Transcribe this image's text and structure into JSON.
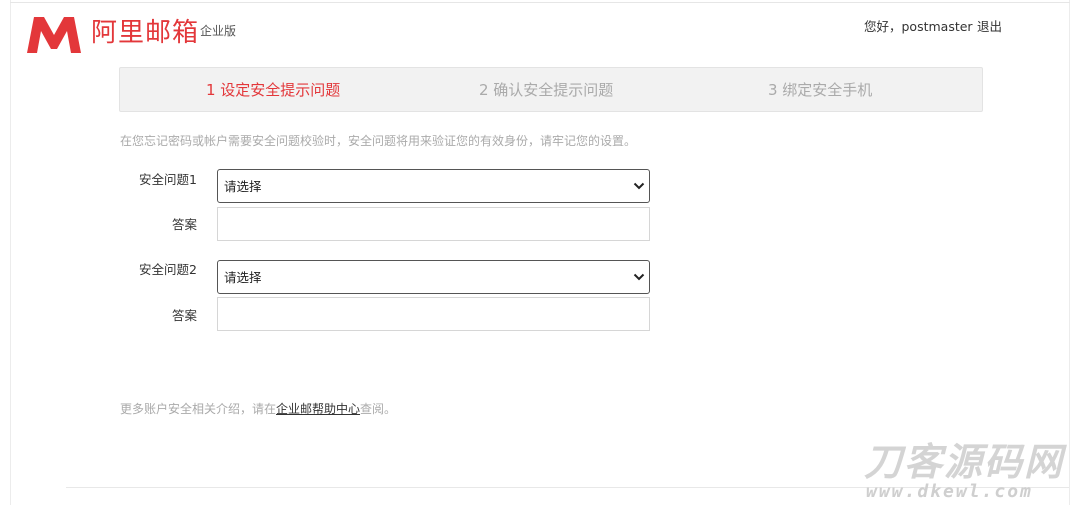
{
  "header": {
    "brand": "阿里邮箱",
    "edition": "企业版",
    "greeting": "您好，postmaster",
    "logout": "退出",
    "logo_color": "#e3373a"
  },
  "steps": [
    {
      "label": "1 设定安全提示问题",
      "active": true
    },
    {
      "label": "2 确认安全提示问题",
      "active": false
    },
    {
      "label": "3 绑定安全手机",
      "active": false
    }
  ],
  "intro": "在您忘记密码或帐户需要安全问题校验时，安全问题将用来验证您的有效身份，请牢记您的设置。",
  "form": {
    "question1_label": "安全问题1",
    "question1_value": "请选择",
    "answer1_label": "答案",
    "answer1_value": "",
    "question2_label": "安全问题2",
    "question2_value": "请选择",
    "answer2_label": "答案",
    "answer2_value": ""
  },
  "footer": {
    "more_prefix": "更多账户安全相关介绍，请在",
    "help_link": "企业邮帮助中心",
    "more_suffix": "查阅。"
  },
  "watermark": {
    "text": "刀客源码网",
    "url": "www.dkewl.com"
  }
}
